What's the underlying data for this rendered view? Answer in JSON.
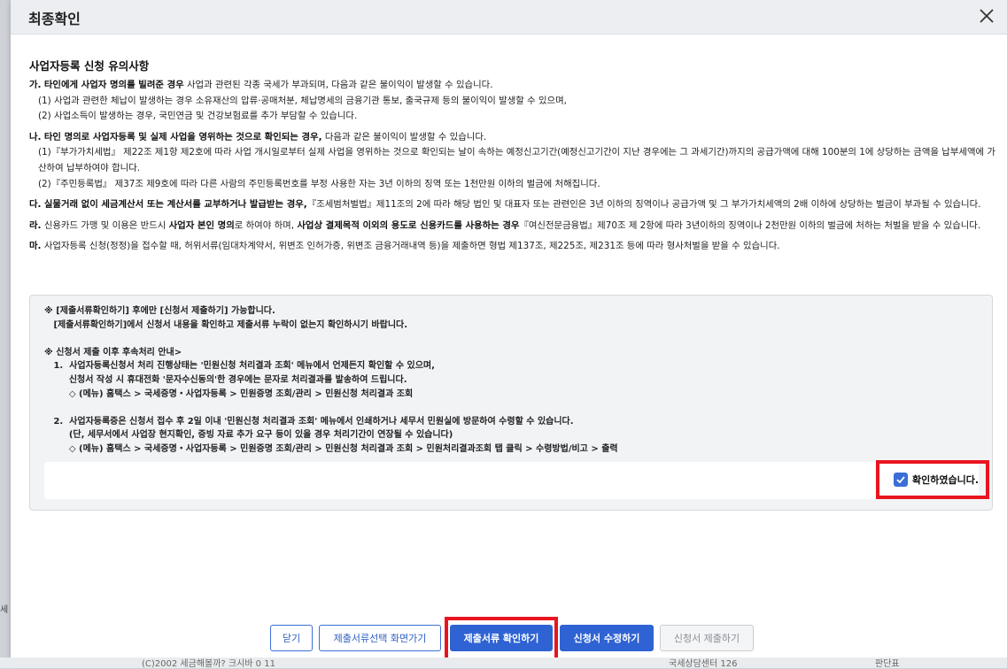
{
  "modal": {
    "title": "최종확인"
  },
  "notice": {
    "title": "사업자등록 신청 유의사항",
    "a": {
      "marker": "가.",
      "bold": "타인에게 사업자 명의를 빌려준 경우",
      "text": " 사업과 관련된 각종 국세가 부과되며, 다음과 같은 불이익이 발생할 수 있습니다.",
      "items": [
        "(1) 사업과 관련한 체납이 발생하는 경우 소유재산의 압류·공매처분, 체납명세의 금융기관 통보, 출국규제 등의 불이익이 발생할 수 있으며,",
        "(2) 사업소득이 발생하는 경우, 국민연금 및 건강보험료를 추가 부담할 수 있습니다."
      ]
    },
    "b": {
      "marker": "나.",
      "bold": "타인 명의로 사업자등록 및 실제 사업을 영위하는 것으로 확인되는 경우,",
      "text": " 다음과 같은 불이익이 발생할 수 있습니다.",
      "items": [
        "(1)『부가가치세법』 제22조 제1항 제2호에 따라 사업 개시일로부터 실제 사업을 영위하는 것으로 확인되는 날이 속하는 예정신고기간(예정신고기간이 지난 경우에는 그 과세기간)까지의 공급가액에 대해 100분의 1에 상당하는 금액을 납부세액에 가산하여 납부하여야 합니다.",
        "(2)『주민등록법』 제37조 제9호에 따라 다른 사람의 주민등록번호를 부정 사용한 자는 3년 이하의 징역 또는 1천만원 이하의 벌금에 처해집니다."
      ]
    },
    "c": {
      "marker": "다.",
      "bold": "실물거래 없이 세금계산서 또는 계산서를 교부하거나 발급받는 경우,",
      "text": "『조세범처벌법』제11조의 2에 따라 해당 법인 및 대표자 또는 관련인은 3년 이하의 징역이나 공급가액 및 그 부가가치세액의 2배 이하에 상당하는 벌금이 부과될 수 있습니다."
    },
    "d": {
      "marker": "라.",
      "text1": " 신용카드 가맹 및 이용은 반드시 ",
      "bold1": "사업자 본인 명의",
      "text2": "로 하여야 하며, ",
      "bold2": "사업상 결제목적 이외의 용도로 신용카드를 사용하는 경우",
      "text3": "『여신전문금융법』제70조 제 2항에 따라 3년이하의 징역이나 2천만원 이하의 벌금에 처하는 처벌을 받을 수 있습니다."
    },
    "e": {
      "marker": "마.",
      "text": " 사업자등록 신청(정정)을 접수할 때, 허위서류(임대차계약서, 위변조 인허가증, 위변조 금융거래내역 등)을 제출하면 형법 제137조, 제225조, 제231조 등에 따라 형사처벌을 받을 수 있습니다."
    }
  },
  "info": {
    "text": "※ [제출서류확인하기] 후에만 [신청서 제출하기] 가능합니다.\n   [제출서류확인하기]에서 신청서 내용을 확인하고 제출서류 누락이 없는지 확인하시기 바랍니다.\n\n※ 신청서 제출 이후 후속처리 안내>\n   1.  사업자등록신청서 처리 진행상태는 '민원신청 처리결과 조회' 메뉴에서 언제든지 확인할 수 있으며,\n        신청서 작성 시 휴대전화 '문자수신동의'한 경우에는 문자로 처리결과를 발송하여 드립니다.\n        ◇ (메뉴) 홈택스 > 국세증명・사업자등록 > 민원증명 조회/관리 > 민원신청 처리결과 조회\n\n   2.  사업자등록증은 신청서 접수 후 2일 이내 '민원신청 처리결과 조회' 메뉴에서 인쇄하거나 세무서 민원실에 방문하여 수령할 수 있습니다.\n        (단, 세무서에서 사업장 현지확인, 증빙 자료 추가 요구 등이 있을 경우 처리기간이 연장될 수 있습니다)\n        ◇ (메뉴) 홈택스 > 국세증명・사업자등록 > 민원증명 조회/관리 > 민원신청 처리결과 조회 > 민원처리결과조회 탭 클릭 > 수령방법/비고 > 출력",
    "confirm_label": "확인하였습니다.",
    "confirm_checked": true
  },
  "buttons": {
    "close": "닫기",
    "select_docs": "제출서류선택 화면가기",
    "check_docs": "제출서류 확인하기",
    "edit_app": "신청서 수정하기",
    "submit_app": "신청서 제출하기"
  },
  "background": {
    "left_edge": "세",
    "bottom_left": "(C)2002 세금해볼까? 크시바 0 11",
    "bottom_mid": "국세상담센터 126",
    "bottom_right": "판단표"
  },
  "colors": {
    "primary": "#2f63d3",
    "highlight": "#e8151f",
    "header_bg": "#eceef1",
    "info_bg": "#f2f3f5"
  }
}
